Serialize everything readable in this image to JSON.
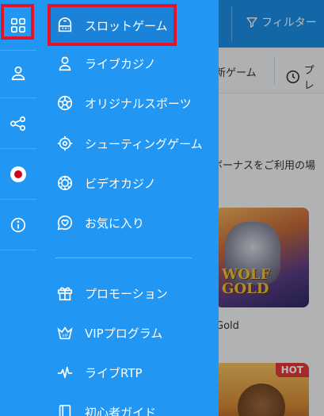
{
  "background": {
    "filter_label": "フィルター",
    "tab_new_games": "新ゲーム",
    "tab_popular": "プレ",
    "notice_text": "ボーナスをご利用の場",
    "card1": {
      "art_text_line1": "WOLF",
      "art_text_line2": "GOLD",
      "label": "Gold"
    },
    "card2": {
      "badge": "HOT"
    }
  },
  "rail": {
    "items": [
      {
        "icon": "grid-icon"
      },
      {
        "icon": "user-icon"
      },
      {
        "icon": "share-icon"
      },
      {
        "icon": "japan-flag-icon"
      },
      {
        "icon": "info-icon"
      }
    ]
  },
  "menu": {
    "items": [
      {
        "label": "スロットゲーム",
        "icon": "slot-machine-icon",
        "active": true
      },
      {
        "label": "ライブカジノ",
        "icon": "live-dealer-icon"
      },
      {
        "label": "オリジナルスポーツ",
        "icon": "soccer-ball-icon"
      },
      {
        "label": "シューティングゲーム",
        "icon": "crosshair-icon"
      },
      {
        "label": "ビデオカジノ",
        "icon": "poker-chip-icon"
      },
      {
        "label": "お気に入り",
        "icon": "heart-chat-icon"
      }
    ],
    "secondary": [
      {
        "label": "プロモーション",
        "icon": "gift-icon"
      },
      {
        "label": "VIPプログラム",
        "icon": "vip-crown-icon"
      },
      {
        "label": "ライブRTP",
        "icon": "pulse-icon"
      },
      {
        "label": "初心者ガイド",
        "icon": "guide-book-icon"
      }
    ]
  },
  "colors": {
    "primary_blue": "#2196f3",
    "highlight_red": "#e3142a"
  }
}
